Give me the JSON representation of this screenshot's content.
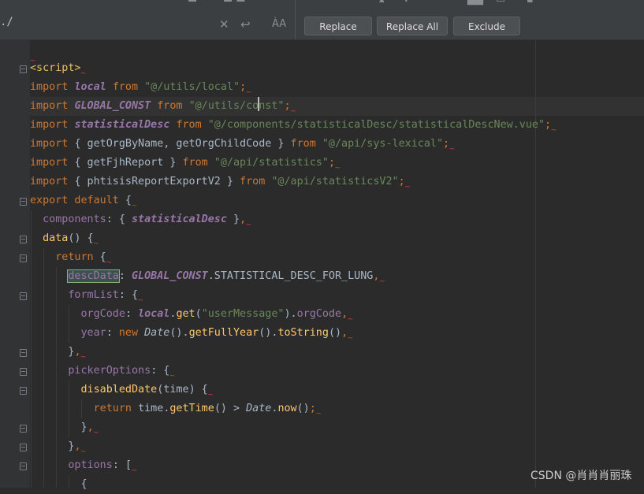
{
  "replace_bar": {
    "search_text": "./",
    "replace_label": "Replace",
    "replace_all_label": "Replace All",
    "exclude_label": "Exclude",
    "clear_icon": "close-icon",
    "newline_icon": "newline-icon",
    "regex_icon": "match-case-icon"
  },
  "code": {
    "l0_tilde": "~",
    "l1_tag": "<script>",
    "l2_kw": "import",
    "l2_id": "local",
    "l2_from": "from",
    "l2_str": "\"@/utils/local\"",
    "l3_kw": "import",
    "l3_id": "GLOBAL_CONST",
    "l3_from": "from",
    "l3_str_a": "\"@/utils/co",
    "l3_str_b": "nst\"",
    "l4_kw": "import",
    "l4_id": "statisticalDesc",
    "l4_from": "from",
    "l4_str": "\"@/components/statisticalDesc/statisticalDescNew.vue\"",
    "l5_kw": "import",
    "l5_body": "{ getOrgByName, getOrgChildCode }",
    "l5_from": "from",
    "l5_str": "\"@/api/sys-lexical\"",
    "l6_kw": "import",
    "l6_body": "{ getFjhReport }",
    "l6_from": "from",
    "l6_str": "\"@/api/statistics\"",
    "l7_kw": "import",
    "l7_body": "{ phtisisReportExportV2 }",
    "l7_from": "from",
    "l7_str": "\"@/api/statisticsV2\"",
    "l8_kw": "export default",
    "l9_prop": "components",
    "l9_id": "statisticalDesc",
    "l10_fn": "data",
    "l11_kw": "return",
    "l12_prop": "descData",
    "l12_const": "GLOBAL_CONST",
    "l12_rest": ".STATISTICAL_DESC_FOR_LUNG",
    "l13_prop": "formList",
    "l14_prop": "orgCode",
    "l14_obj": "local",
    "l14_fn": "get",
    "l14_str": "\"userMessage\"",
    "l14_prop2": "orgCode",
    "l15_prop": "year",
    "l15_kw": "new",
    "l15_cls": "Date",
    "l15_fn1": "getFullYear",
    "l15_fn2": "toString",
    "l17_prop": "pickerOptions",
    "l18_fn": "disabledDate",
    "l18_param": "time",
    "l19_kw": "return",
    "l19_obj": "time",
    "l19_fn": "getTime",
    "l19_cls": "Date",
    "l19_fn2": "now",
    "l22_prop": "options"
  },
  "watermark": "CSDN @肖肖肖丽珠",
  "colors": {
    "keyword": "#cc7832",
    "string": "#6a8759",
    "constant": "#9876aa",
    "function": "#ffc66d",
    "tag": "#e8bf6a",
    "background": "#2b2b2b"
  }
}
